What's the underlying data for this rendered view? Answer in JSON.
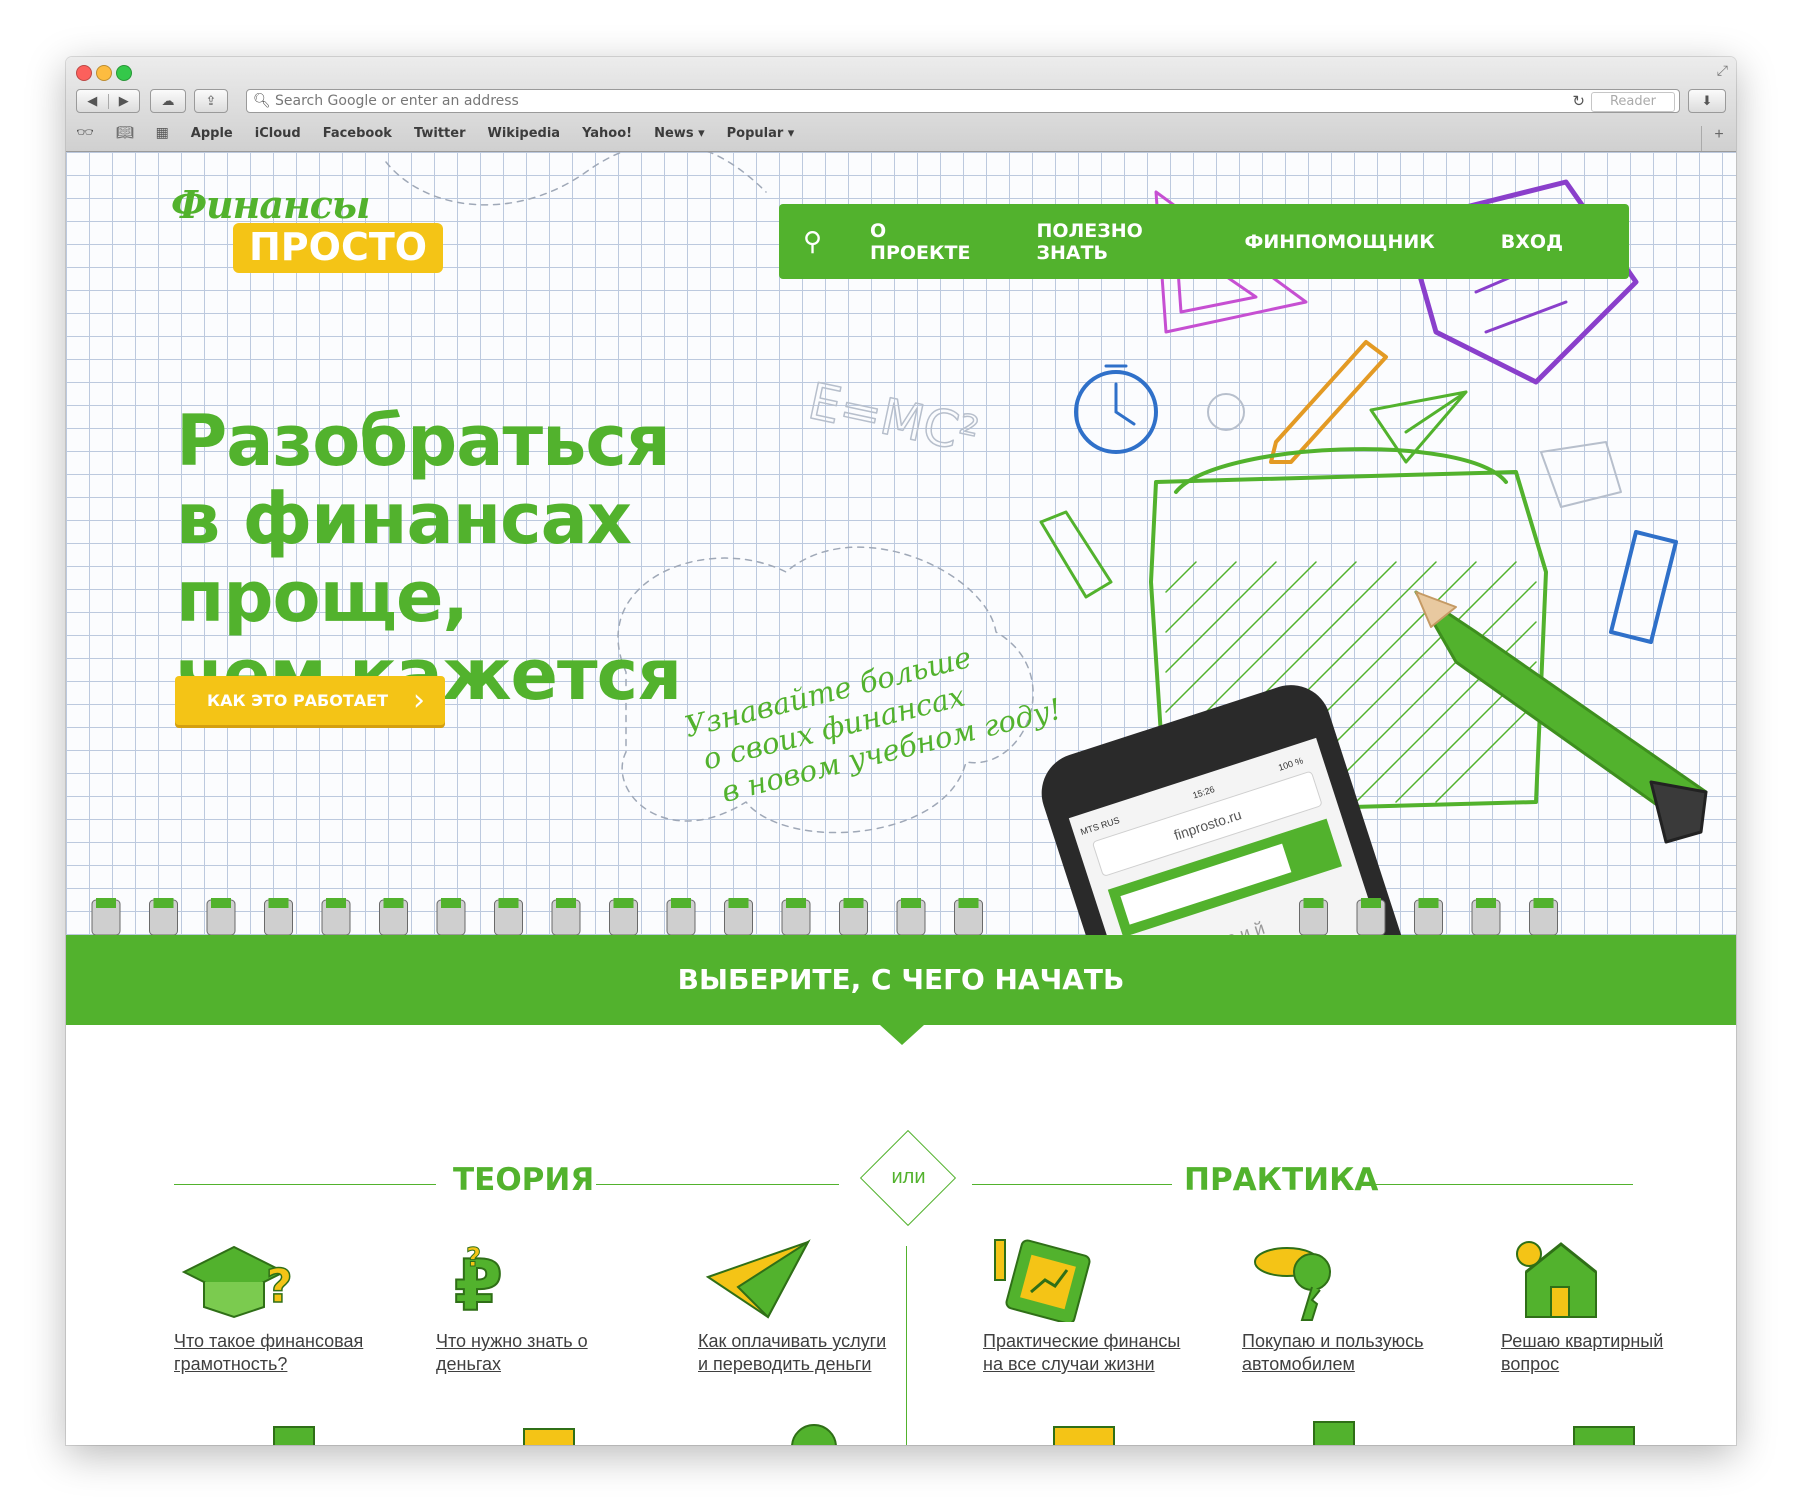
{
  "browser": {
    "address_placeholder": "Search Google or enter an address",
    "reader_label": "Reader",
    "bookmarks": [
      "Apple",
      "iCloud",
      "Facebook",
      "Twitter",
      "Wikipedia",
      "Yahoo!",
      "News ▾",
      "Popular ▾"
    ]
  },
  "site": {
    "logo_line1": "Финансы",
    "logo_line2": "ПРОСТО",
    "menu": [
      "О ПРОЕКТЕ",
      "ПОЛЕЗНО ЗНАТЬ",
      "ФИНПОМОЩНИК",
      "ВХОД"
    ],
    "headline": [
      "Разобраться",
      "в финансах проще,",
      "чем кажется"
    ],
    "cta_label": "КАК ЭТО РАБОТАЕТ",
    "handwritten": [
      "Узнавайте больше",
      "о своих финансах",
      "в новом учебном году!"
    ],
    "phone_url": "finprosto.ru",
    "phone_carrier": "MTS RUS",
    "phone_time": "15:26",
    "phone_battery": "100 %",
    "phone_keys": "в г д е ё ж з и й",
    "formula": "E=MC²"
  },
  "choose": {
    "title": "ВЫБЕРИТЕ, С ЧЕГО НАЧАТЬ",
    "theory_title": "ТЕОРИЯ",
    "or_label": "или",
    "practice_title": "ПРАКТИКА"
  },
  "cards": [
    {
      "text": "Что такое финансовая грамотность?",
      "icon": "graduation-cap-icon"
    },
    {
      "text": "Что нужно знать о деньгах",
      "icon": "ruble-question-icon"
    },
    {
      "text": "Как оплачивать услуги и переводить деньги",
      "icon": "paper-plane-icon"
    },
    {
      "text": "Практические финансы на все случаи жизни",
      "icon": "tablet-chart-icon"
    },
    {
      "text": "Покупаю и пользуюсь автомобилем",
      "icon": "car-key-icon"
    },
    {
      "text": "Решаю квартирный вопрос",
      "icon": "house-icon"
    }
  ],
  "colors": {
    "brand_green": "#52b22d",
    "brand_yellow": "#f4c416"
  }
}
